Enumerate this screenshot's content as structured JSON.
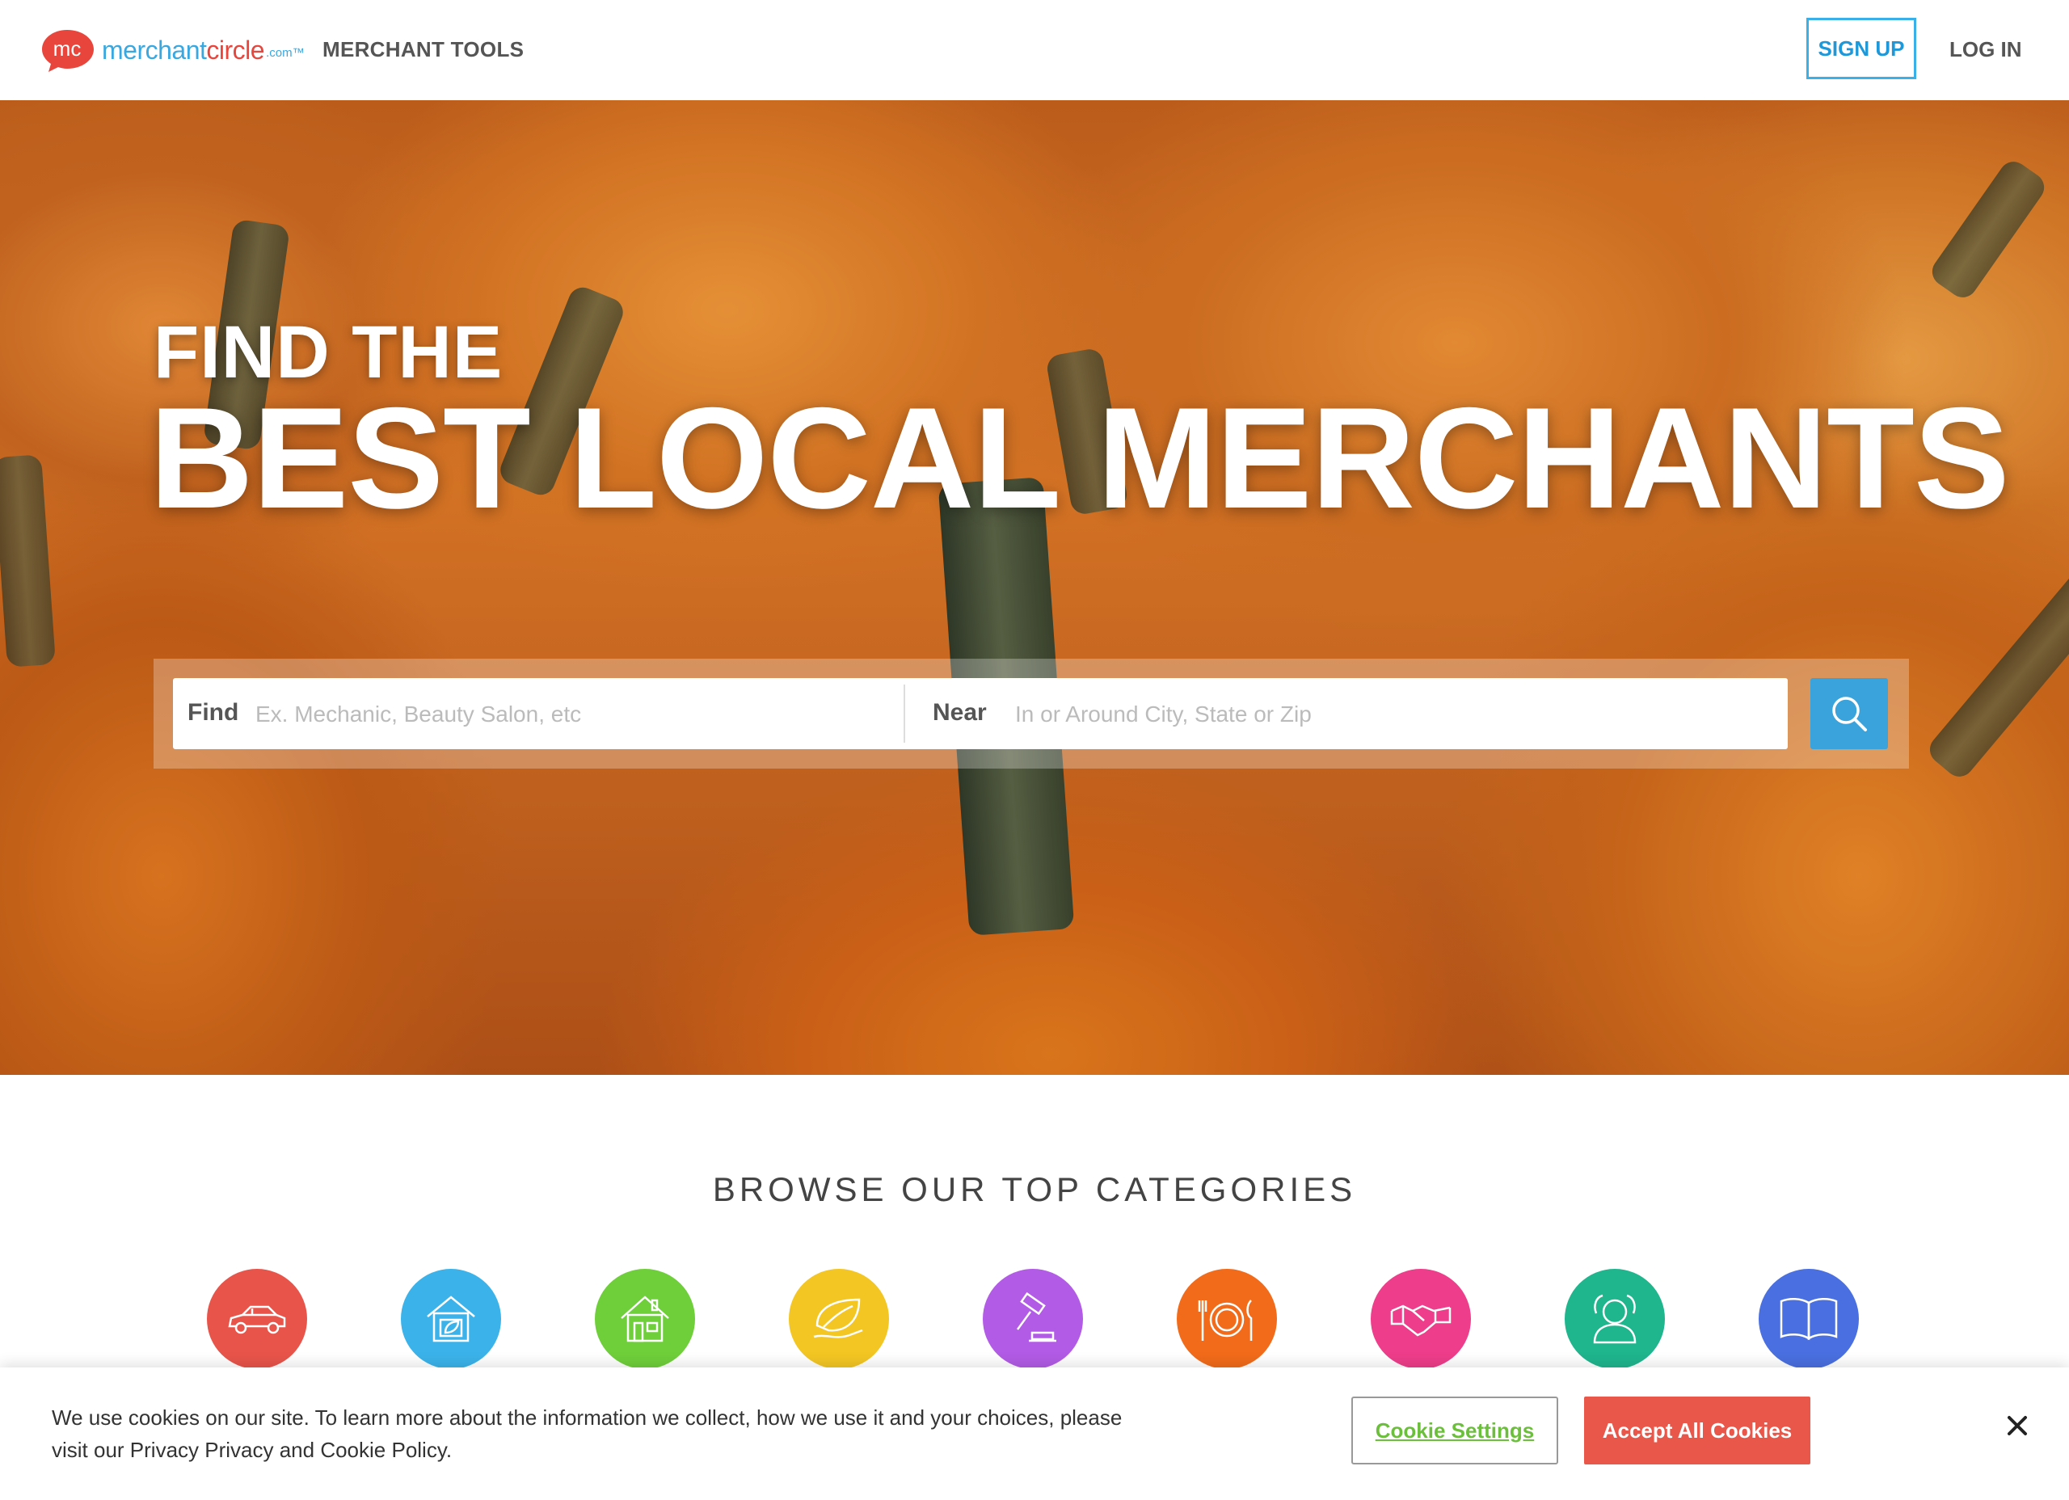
{
  "header": {
    "logo_text_a": "merchant",
    "logo_text_b": "circle",
    "logo_tld": ".com™",
    "logo_badge": "mc",
    "nav_tools": "MERCHANT TOOLS",
    "signup": "SIGN UP",
    "login": "LOG IN"
  },
  "hero": {
    "title_small": "FIND THE",
    "title_big": "BEST LOCAL MERCHANTS"
  },
  "search": {
    "find_label": "Find",
    "find_placeholder": "Ex. Mechanic, Beauty Salon, etc",
    "near_label": "Near",
    "near_placeholder": "In or Around City, State or Zip",
    "button_icon": "search-icon"
  },
  "categories": {
    "title": "BROWSE OUR TOP CATEGORIES",
    "items": [
      {
        "icon": "car-icon",
        "color": "#e8544a"
      },
      {
        "icon": "home-leaf-icon",
        "color": "#3bb3ea"
      },
      {
        "icon": "house-icon",
        "color": "#6fcf3a"
      },
      {
        "icon": "leaf-hand-icon",
        "color": "#f3c623"
      },
      {
        "icon": "gavel-icon",
        "color": "#b25be6"
      },
      {
        "icon": "dining-icon",
        "color": "#f26b1a"
      },
      {
        "icon": "handshake-icon",
        "color": "#ee3d8a"
      },
      {
        "icon": "people-icon",
        "color": "#1fb58d"
      },
      {
        "icon": "book-icon",
        "color": "#4a6fe0"
      }
    ]
  },
  "cookie": {
    "text": "We use cookies on our site. To learn more about the information we collect, how we use it and your choices, please visit our Privacy Privacy and Cookie Policy.",
    "settings": "Cookie Settings",
    "accept": "Accept All Cookies",
    "close_icon": "close-icon"
  },
  "colors": {
    "brand_blue": "#3aa8e0",
    "brand_red": "#e8453c",
    "accept_red": "#e8574a",
    "settings_green": "#6cbf3c"
  }
}
